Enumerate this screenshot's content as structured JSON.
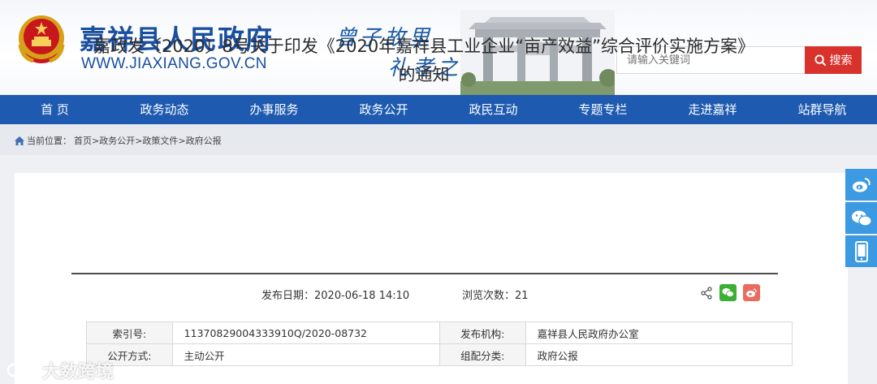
{
  "header": {
    "site_title": "嘉祥县人民政府",
    "site_domain": "WWW.JIAXIANG.GOV.CN",
    "slogan_line1": "曾子故里",
    "slogan_line2": "礼孝之城",
    "search_placeholder": "请输入关键词",
    "search_button": "搜索"
  },
  "nav": {
    "items": [
      "首 页",
      "政务动态",
      "办事服务",
      "政务公开",
      "政民互动",
      "专题专栏",
      "走进嘉祥",
      "站群导航"
    ]
  },
  "breadcrumb": {
    "prefix": "当前位置：",
    "path": "首页>政务公开>政策文件>政府公报"
  },
  "article": {
    "title_line1": "嘉政发〔2020〕8号关于印发《2020年嘉祥县工业企业“亩产效益”综合评价实施方案》",
    "title_line2": "的通知",
    "publish_date_label": "发布日期：",
    "publish_date": "2020-06-18 14:10",
    "views_label": "浏览次数：",
    "views": "21"
  },
  "info_table": {
    "index_label": "索引号:",
    "index_value": "11370829004333910Q/2020-08732",
    "org_label": "发布机构:",
    "org_value": "嘉祥县人民政府办公室",
    "public_label": "公开方式:",
    "public_value": "主动公开",
    "category_label": "组配分类:",
    "category_value": "政府公报"
  },
  "watermark": "大数跨境",
  "colors": {
    "nav_bg": "#1d5ab0",
    "title_blue": "#1a4fa0",
    "search_red": "#d9322d",
    "float_blue": "#3b9ae1"
  }
}
